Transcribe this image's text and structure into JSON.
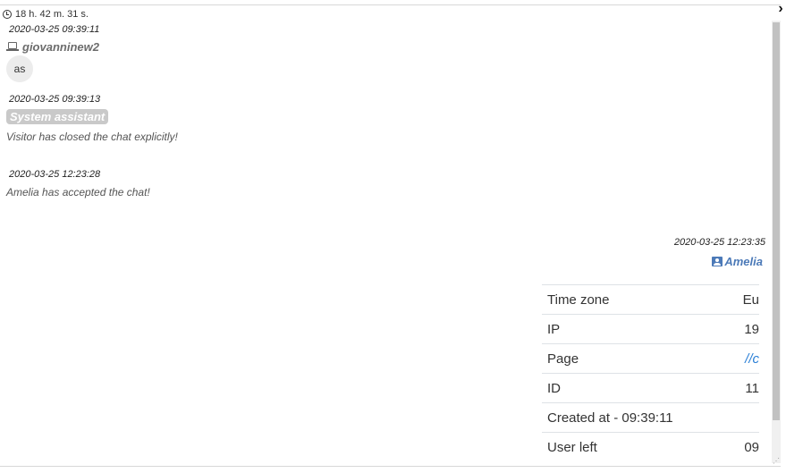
{
  "header": {
    "duration": "18 h. 42 m. 31 s."
  },
  "messages": [
    {
      "timestamp": "2020-03-25 09:39:11",
      "sender": "giovanninew2",
      "text": "as"
    },
    {
      "timestamp": "2020-03-25 09:39:13",
      "sender": "System assistant",
      "text": "Visitor has closed the chat explicitly!"
    },
    {
      "timestamp": "2020-03-25 12:23:28",
      "text": "Amelia has accepted the chat!"
    },
    {
      "timestamp": "2020-03-25 12:23:35",
      "sender": "Amelia"
    }
  ],
  "info_table": [
    {
      "label": "Time zone",
      "value": "Eu"
    },
    {
      "label": "IP",
      "value": "19"
    },
    {
      "label": "Page",
      "value": "//c"
    },
    {
      "label": "ID",
      "value": "11"
    },
    {
      "label": "Created at - 09:39:11",
      "value": ""
    },
    {
      "label": "User left",
      "value": "09"
    }
  ],
  "colors": {
    "operator": "#4c7ab8",
    "link": "#2a7fd6",
    "system_badge": "#c9c9c9"
  }
}
